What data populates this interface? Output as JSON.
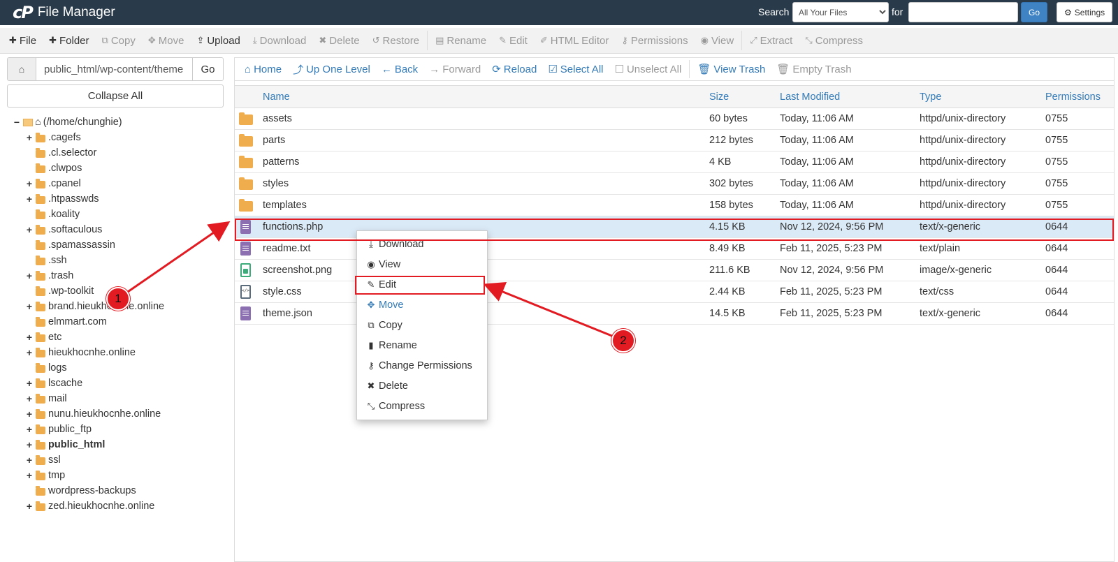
{
  "header": {
    "logo": "cP",
    "title": "File Manager",
    "search_label": "Search",
    "search_scope": "All Your Files",
    "for_label": "for",
    "search_value": "",
    "go_label": "Go",
    "settings_label": "Settings"
  },
  "toolbar": [
    {
      "label": "File",
      "icon": "plus-icon",
      "glyph": "✚",
      "enabled": true
    },
    {
      "label": "Folder",
      "icon": "plus-icon",
      "glyph": "✚",
      "enabled": true
    },
    {
      "label": "Copy",
      "icon": "copy-icon",
      "glyph": "⧉",
      "enabled": false
    },
    {
      "label": "Move",
      "icon": "move-icon",
      "glyph": "✥",
      "enabled": false
    },
    {
      "label": "Upload",
      "icon": "upload-icon",
      "glyph": "⇪",
      "enabled": true
    },
    {
      "label": "Download",
      "icon": "download-icon",
      "glyph": "⤓",
      "enabled": false
    },
    {
      "label": "Delete",
      "icon": "delete-icon",
      "glyph": "✖",
      "enabled": false
    },
    {
      "label": "Restore",
      "icon": "restore-icon",
      "glyph": "↺",
      "enabled": false
    },
    {
      "label": "Rename",
      "icon": "rename-icon",
      "glyph": "▤",
      "enabled": false
    },
    {
      "label": "Edit",
      "icon": "pencil-icon",
      "glyph": "✎",
      "enabled": false
    },
    {
      "label": "HTML Editor",
      "icon": "html-editor-icon",
      "glyph": "✐",
      "enabled": false
    },
    {
      "label": "Permissions",
      "icon": "key-icon",
      "glyph": "⚷",
      "enabled": false
    },
    {
      "label": "View",
      "icon": "eye-icon",
      "glyph": "◉",
      "enabled": false
    },
    {
      "label": "Extract",
      "icon": "extract-icon",
      "glyph": "⤢",
      "enabled": false
    },
    {
      "label": "Compress",
      "icon": "compress-icon",
      "glyph": "⤡",
      "enabled": false
    }
  ],
  "address": {
    "path": "public_html/wp-content/theme",
    "go_label": "Go",
    "collapse_label": "Collapse All"
  },
  "tree": [
    {
      "name": "(/home/chunghie)",
      "expander": "−",
      "root": true
    },
    {
      "name": ".cagefs",
      "expander": "+"
    },
    {
      "name": ".cl.selector",
      "expander": ""
    },
    {
      "name": ".clwpos",
      "expander": ""
    },
    {
      "name": ".cpanel",
      "expander": "+"
    },
    {
      "name": ".htpasswds",
      "expander": "+"
    },
    {
      "name": ".koality",
      "expander": ""
    },
    {
      "name": ".softaculous",
      "expander": "+"
    },
    {
      "name": ".spamassassin",
      "expander": ""
    },
    {
      "name": ".ssh",
      "expander": ""
    },
    {
      "name": ".trash",
      "expander": "+"
    },
    {
      "name": ".wp-toolkit",
      "expander": ""
    },
    {
      "name": "brand.hieukhocnhe.online",
      "expander": "+"
    },
    {
      "name": "elmmart.com",
      "expander": ""
    },
    {
      "name": "etc",
      "expander": "+"
    },
    {
      "name": "hieukhocnhe.online",
      "expander": "+"
    },
    {
      "name": "logs",
      "expander": ""
    },
    {
      "name": "lscache",
      "expander": "+"
    },
    {
      "name": "mail",
      "expander": "+"
    },
    {
      "name": "nunu.hieukhocnhe.online",
      "expander": "+"
    },
    {
      "name": "public_ftp",
      "expander": "+"
    },
    {
      "name": "public_html",
      "expander": "+",
      "bold": true
    },
    {
      "name": "ssl",
      "expander": "+"
    },
    {
      "name": "tmp",
      "expander": "+"
    },
    {
      "name": "wordpress-backups",
      "expander": ""
    },
    {
      "name": "zed.hieukhocnhe.online",
      "expander": "+"
    }
  ],
  "nav": [
    {
      "label": "Home",
      "icon": "home-icon",
      "glyph": "⌂",
      "enabled": true
    },
    {
      "label": "Up One Level",
      "icon": "level-up-icon",
      "glyph": "⤴",
      "enabled": true
    },
    {
      "label": "Back",
      "icon": "arrow-left-icon",
      "glyph": "←",
      "enabled": true
    },
    {
      "label": "Forward",
      "icon": "arrow-right-icon",
      "glyph": "→",
      "enabled": false
    },
    {
      "label": "Reload",
      "icon": "reload-icon",
      "glyph": "⟳",
      "enabled": true
    },
    {
      "label": "Select All",
      "icon": "check-square-icon",
      "glyph": "☑",
      "enabled": true
    },
    {
      "label": "Unselect All",
      "icon": "square-icon",
      "glyph": "☐",
      "enabled": false
    },
    {
      "label": "View Trash",
      "icon": "trash-icon",
      "glyph": "🗑",
      "enabled": true
    },
    {
      "label": "Empty Trash",
      "icon": "trash-icon",
      "glyph": "🗑",
      "enabled": false
    }
  ],
  "table": {
    "columns": {
      "name": "Name",
      "size": "Size",
      "modified": "Last Modified",
      "type": "Type",
      "perms": "Permissions"
    },
    "rows": [
      {
        "icon": "folder",
        "name": "assets",
        "size": "60 bytes",
        "modified": "Today, 11:06 AM",
        "type": "httpd/unix-directory",
        "perms": "0755"
      },
      {
        "icon": "folder",
        "name": "parts",
        "size": "212 bytes",
        "modified": "Today, 11:06 AM",
        "type": "httpd/unix-directory",
        "perms": "0755"
      },
      {
        "icon": "folder",
        "name": "patterns",
        "size": "4 KB",
        "modified": "Today, 11:06 AM",
        "type": "httpd/unix-directory",
        "perms": "0755"
      },
      {
        "icon": "folder",
        "name": "styles",
        "size": "302 bytes",
        "modified": "Today, 11:06 AM",
        "type": "httpd/unix-directory",
        "perms": "0755"
      },
      {
        "icon": "folder",
        "name": "templates",
        "size": "158 bytes",
        "modified": "Today, 11:06 AM",
        "type": "httpd/unix-directory",
        "perms": "0755"
      },
      {
        "icon": "generic",
        "name": "functions.php",
        "size": "4.15 KB",
        "modified": "Nov 12, 2024, 9:56 PM",
        "type": "text/x-generic",
        "perms": "0644",
        "selected": true
      },
      {
        "icon": "generic",
        "name": "readme.txt",
        "size": "8.49 KB",
        "modified": "Feb 11, 2025, 5:23 PM",
        "type": "text/plain",
        "perms": "0644"
      },
      {
        "icon": "img",
        "name": "screenshot.png",
        "size": "211.6 KB",
        "modified": "Nov 12, 2024, 9:56 PM",
        "type": "image/x-generic",
        "perms": "0644"
      },
      {
        "icon": "code",
        "name": "style.css",
        "size": "2.44 KB",
        "modified": "Feb 11, 2025, 5:23 PM",
        "type": "text/css",
        "perms": "0644"
      },
      {
        "icon": "generic",
        "name": "theme.json",
        "size": "14.5 KB",
        "modified": "Feb 11, 2025, 5:23 PM",
        "type": "text/x-generic",
        "perms": "0644"
      }
    ]
  },
  "context_menu": [
    {
      "label": "Download",
      "icon": "download-icon",
      "glyph": "⤓"
    },
    {
      "label": "View",
      "icon": "eye-icon",
      "glyph": "◉"
    },
    {
      "label": "Edit",
      "icon": "pencil-icon",
      "glyph": "✎"
    },
    {
      "label": "Move",
      "icon": "move-icon",
      "glyph": "✥",
      "blue": true
    },
    {
      "label": "Copy",
      "icon": "copy-icon",
      "glyph": "⧉"
    },
    {
      "label": "Rename",
      "icon": "file-icon",
      "glyph": "▮"
    },
    {
      "label": "Change Permissions",
      "icon": "key-icon",
      "glyph": "⚷"
    },
    {
      "label": "Delete",
      "icon": "close-icon",
      "glyph": "✖"
    },
    {
      "label": "Compress",
      "icon": "compress-icon",
      "glyph": "⤡"
    }
  ],
  "annotations": {
    "step1": "1",
    "step2": "2",
    "color": "#e21b22"
  }
}
